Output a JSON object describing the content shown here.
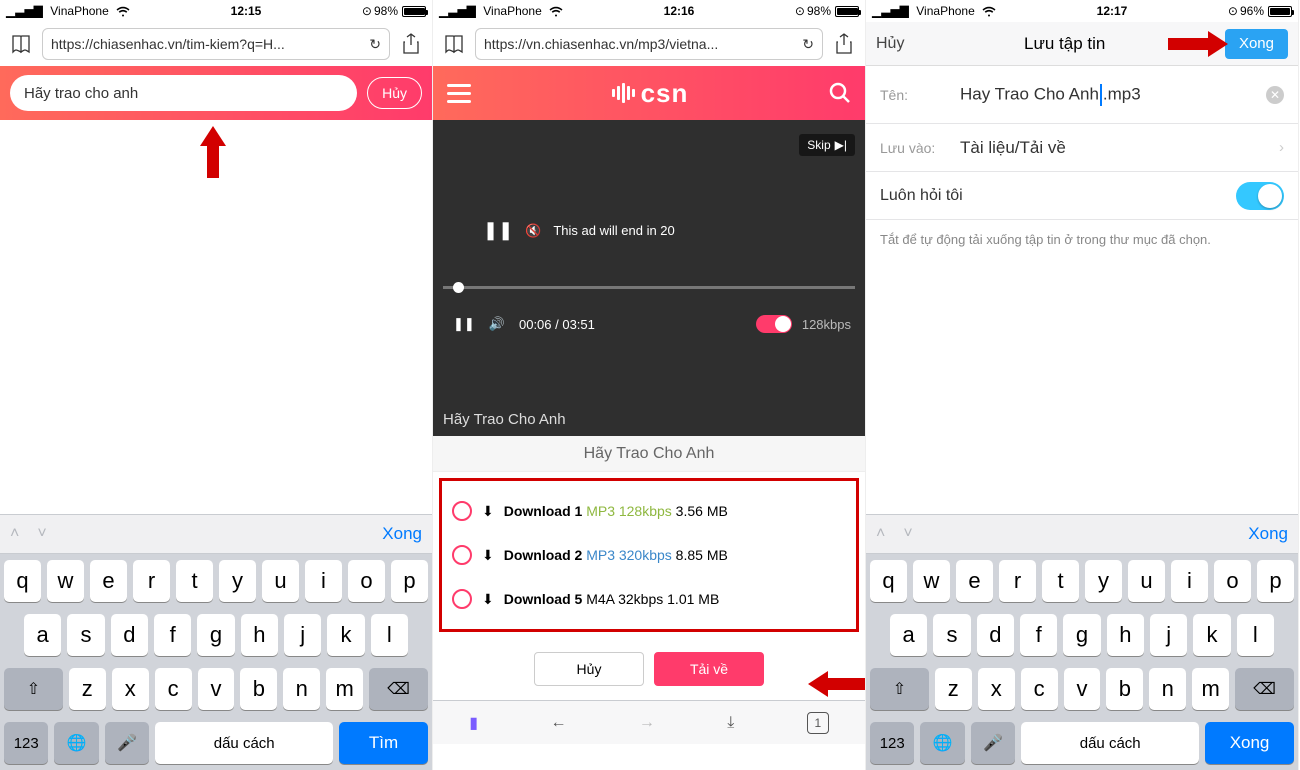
{
  "status": {
    "carrier": "VinaPhone",
    "t1": "12:15",
    "t2": "12:16",
    "t3": "12:17",
    "b1": "98%",
    "b2": "98%",
    "b3": "96%"
  },
  "s1": {
    "url": "https://chiasenhac.vn/tim-kiem?q=H...",
    "search_value": "Hãy trao cho anh",
    "cancel": "Hủy",
    "kbar_done": "Xong",
    "space": "dấu cách",
    "num": "123",
    "submit": "Tìm"
  },
  "s2": {
    "url": "https://vn.chiasenhac.vn/mp3/vietna...",
    "logo": "csn",
    "skip": "Skip",
    "ad": "This ad will end in 20",
    "time": "00:06 / 03:51",
    "kbps": "128kbps",
    "video_title": "Hãy Trao Cho Anh",
    "song_title": "Hãy Trao Cho Anh",
    "dl": [
      {
        "label": "Download 1",
        "fmt": "MP3 128kbps",
        "cls": "mp3g",
        "size": "3.56 MB"
      },
      {
        "label": "Download 2",
        "fmt": "MP3 320kbps",
        "cls": "mp3b",
        "size": "8.85 MB"
      },
      {
        "label": "Download 5",
        "fmt": "M4A 32kbps",
        "cls": "",
        "size": "1.01 MB"
      }
    ],
    "btn_cancel": "Hủy",
    "btn_dl": "Tải về",
    "tabcount": "1"
  },
  "s3": {
    "cancel": "Hủy",
    "title": "Lưu tập tin",
    "done": "Xong",
    "name_lbl": "Tên:",
    "name_val_a": "Hay Trao Cho Anh",
    "name_ext": ".mp3",
    "save_lbl": "Lưu vào:",
    "save_val": "Tài liệu/Tải về",
    "ask": "Luôn hỏi tôi",
    "note": "Tắt để tự động tải xuống tập tin ở trong thư mục đã chọn.",
    "space": "dấu cách",
    "num": "123",
    "submit": "Xong",
    "kbar_done": "Xong"
  },
  "keys": {
    "row1": [
      "q",
      "w",
      "e",
      "r",
      "t",
      "y",
      "u",
      "i",
      "o",
      "p"
    ],
    "row2": [
      "a",
      "s",
      "d",
      "f",
      "g",
      "h",
      "j",
      "k",
      "l"
    ],
    "row3": [
      "z",
      "x",
      "c",
      "v",
      "b",
      "n",
      "m"
    ]
  }
}
